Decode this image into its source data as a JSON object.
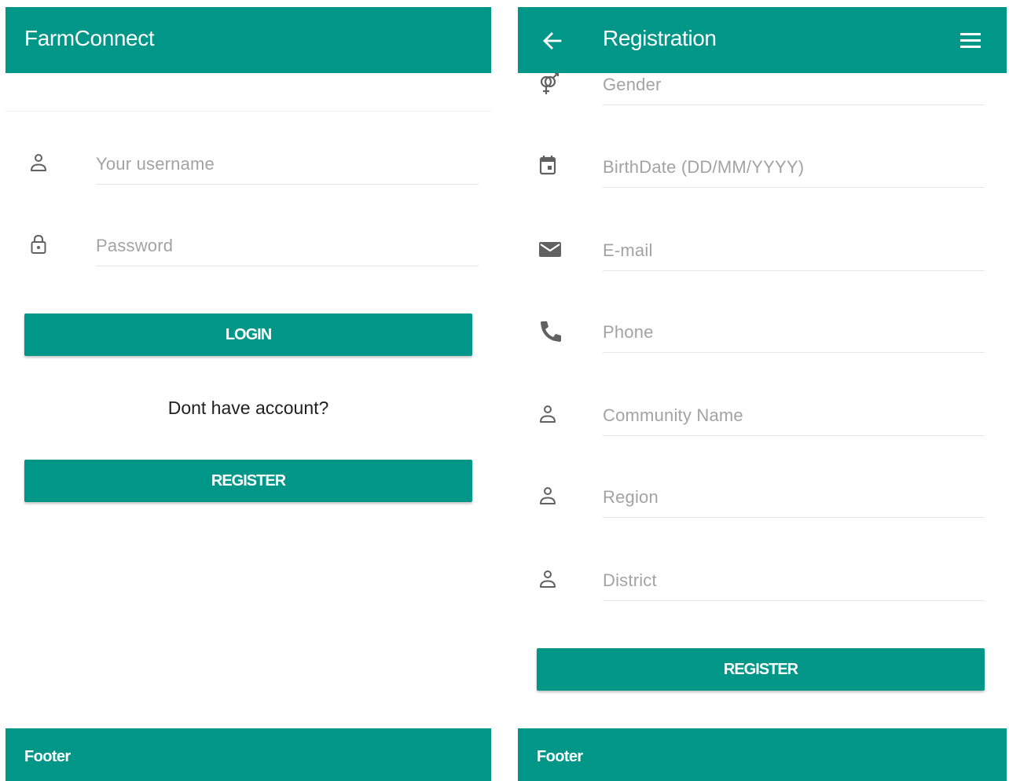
{
  "colors": {
    "primary": "#009688",
    "icon": "#616161",
    "placeholder": "#a3a3a3"
  },
  "login": {
    "app_title": "FarmConnect",
    "username": {
      "icon": "person-icon",
      "placeholder": "Your username",
      "value": ""
    },
    "password": {
      "icon": "lock-icon",
      "placeholder": "Password",
      "value": ""
    },
    "login_label": "LOGIN",
    "register_prompt": "Dont have account?",
    "register_label": "REGISTER",
    "footer": "Footer"
  },
  "registration": {
    "title": "Registration",
    "back_icon": "arrow-back-icon",
    "menu_icon": "hamburger-menu-icon",
    "fields": [
      {
        "icon": "gender-icon",
        "placeholder": "Gender",
        "value": ""
      },
      {
        "icon": "calendar-icon",
        "placeholder": "BirthDate (DD/MM/YYYY)",
        "value": ""
      },
      {
        "icon": "email-icon",
        "placeholder": "E-mail",
        "value": ""
      },
      {
        "icon": "phone-icon",
        "placeholder": "Phone",
        "value": ""
      },
      {
        "icon": "person-icon",
        "placeholder": "Community Name",
        "value": ""
      },
      {
        "icon": "person-icon",
        "placeholder": "Region",
        "value": ""
      },
      {
        "icon": "person-icon",
        "placeholder": "District",
        "value": ""
      }
    ],
    "register_label": "REGISTER",
    "footer": "Footer"
  }
}
